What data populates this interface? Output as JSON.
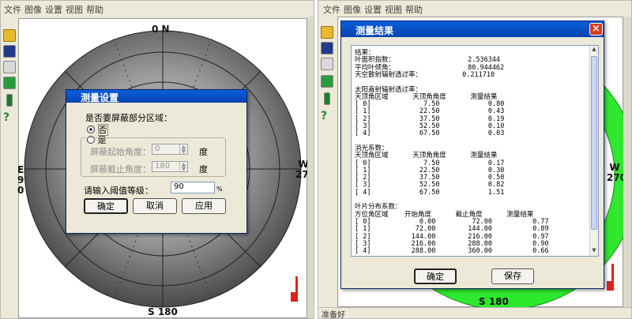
{
  "menu": [
    "文件",
    "图像",
    "设置",
    "视图",
    "帮助"
  ],
  "compass": {
    "north": "0 N",
    "south": "S 180",
    "east": "E 90",
    "west": "W 270"
  },
  "settings_dialog": {
    "title": "测量设置",
    "question": "是否要屏蔽部分区域：",
    "radio_no": "否",
    "radio_yes": "是",
    "mask_start_label": "屏蔽起始角度：",
    "mask_start_value": "0",
    "mask_end_label": "屏蔽截止角度：",
    "mask_end_value": "180",
    "degree_unit": "度",
    "threshold_label": "请输入阈值等级：",
    "threshold_value": "90",
    "percent_unit": "%",
    "ok_label": "确定",
    "cancel_label": "取消",
    "apply_label": "应用"
  },
  "result_dialog": {
    "title": "测量结果",
    "close_label": "×",
    "ok_label": "确定",
    "save_label": "保存",
    "lines": [
      "结果：",
      "叶面积指数：                  2.536344",
      "平均叶倾角：                  80.944462",
      "天空散射辐射透过率：          0.211710",
      "",
      "太阳直射辐射透过率：",
      "天顶角区域      天顶角角度      测量结果",
      "[ 0]             7.50            0.80",
      "[ 1]            22.50            0.43",
      "[ 2]            37.50            0.19",
      "[ 3]            52.50            0.10",
      "[ 4]            67.50            0.03",
      "",
      "消光系数：",
      "天顶角区域      天顶角角度      测量结果",
      "[ 0]             7.50            0.17",
      "[ 1]            22.50            0.30",
      "[ 2]            37.50            0.50",
      "[ 3]            52.50            0.82",
      "[ 4]            67.50            1.51",
      "",
      "叶片分布系数：",
      "方位角区域    开始角度      截止角度      测量结果",
      "[ 0]            0.00         72.00          0.77",
      "[ 1]           72.00        144.00          0.89",
      "[ 2]          144.00        216.00          0.97",
      "[ 3]          216.00        288.00          0.90",
      "[ 4]          288.00        360.00          0.66"
    ]
  },
  "status_text": "准备好",
  "colors": {
    "mask_ring": "#2ee82e",
    "title_blue": "#0a5fd8",
    "close_red": "#d83a1f",
    "scale_red": "#e02020"
  }
}
